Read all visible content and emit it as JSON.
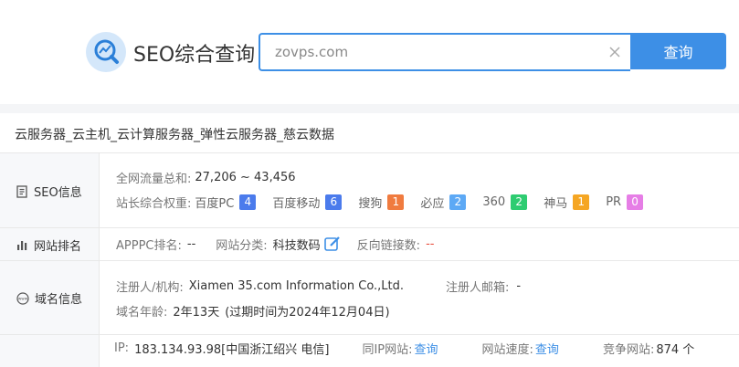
{
  "header": {
    "logo_text": "SEO综合查询",
    "search_value": "zovps.com",
    "search_button": "查询"
  },
  "site_title": "云服务器_云主机_云计算服务器_弹性云服务器_慈云数据",
  "seo": {
    "label": "SEO信息",
    "traffic_label": "全网流量总和:",
    "traffic_value": "27,206 ~ 43,456",
    "weight_label": "站长综合权重:",
    "weights": [
      {
        "name": "百度PC",
        "value": "4",
        "color": "#4b7bec"
      },
      {
        "name": "百度移动",
        "value": "6",
        "color": "#4b7bec"
      },
      {
        "name": "搜狗",
        "value": "1",
        "color": "#f07b3f"
      },
      {
        "name": "必应",
        "value": "2",
        "color": "#5da9f5"
      },
      {
        "name": "360",
        "value": "2",
        "color": "#2ecc71"
      },
      {
        "name": "神马",
        "value": "1",
        "color": "#f5a623"
      },
      {
        "name": "PR",
        "value": "0",
        "color": "#e67ee6"
      }
    ]
  },
  "rank": {
    "label": "网站排名",
    "apppc_label": "APPPC排名:",
    "apppc_value": "--",
    "category_label": "网站分类:",
    "category_value": "科技数码",
    "backlinks_label": "反向链接数:",
    "backlinks_value": "--"
  },
  "domain": {
    "label": "域名信息",
    "registrant_label": "注册人/机构:",
    "registrant_value": "Xiamen 35.com Information Co.,Ltd.",
    "email_label": "注册人邮箱:",
    "email_value": "-",
    "age_label": "域名年龄:",
    "age_value": "2年13天",
    "expire_text": "(过期时间为2024年12月04日)"
  },
  "ip": {
    "ip_label": "IP:",
    "ip_value": "183.134.93.98[中国浙江绍兴 电信]",
    "same_ip_label": "同IP网站:",
    "same_ip_link": "查询",
    "speed_label": "网站速度:",
    "speed_link": "查询",
    "compete_label": "竞争网站:",
    "compete_value": "874 个"
  },
  "colors": {
    "accent": "#3d8fe6",
    "badge_red": "#e74c3c"
  }
}
